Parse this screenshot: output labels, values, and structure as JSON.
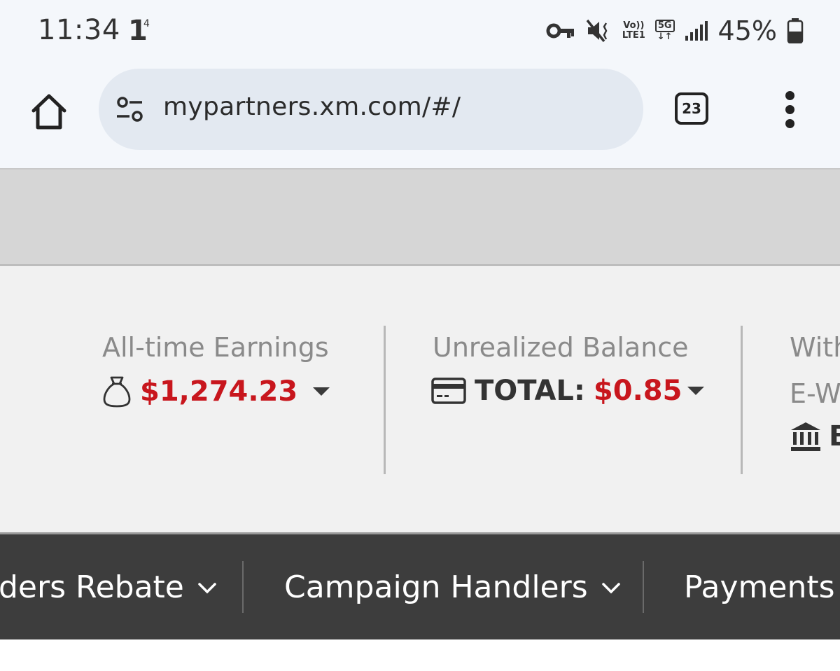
{
  "status_bar": {
    "time": "11:34",
    "notification": "1",
    "notification_sup": "4",
    "volte_line1": "Vo))",
    "volte_line2": "LTE1",
    "network": "5G",
    "battery_percent": "45%",
    "icons": [
      "key-icon",
      "mute-vibrate-icon",
      "volte-icon",
      "5g-icon",
      "signal-icon",
      "battery-icon"
    ]
  },
  "browser": {
    "url": "mypartners.xm.com/#/",
    "tab_count": "23"
  },
  "stats": {
    "earnings_label": "All-time Earnings",
    "earnings_value": "$1,274.23",
    "unrealized_label": "Unrealized Balance",
    "unrealized_total_label": "TOTAL:",
    "unrealized_total_value": "$0.85",
    "withdraw_label_partial": "With",
    "withdraw_method_partial": "E-W",
    "withdraw_bank_partial": "B"
  },
  "nav": {
    "items": [
      {
        "label": "ders Rebate"
      },
      {
        "label": "Campaign Handlers"
      },
      {
        "label": "Payments"
      }
    ]
  },
  "colors": {
    "accent_red": "#c8161d",
    "nav_bg": "#3d3d3d",
    "stats_bg": "#f1f1f1"
  }
}
